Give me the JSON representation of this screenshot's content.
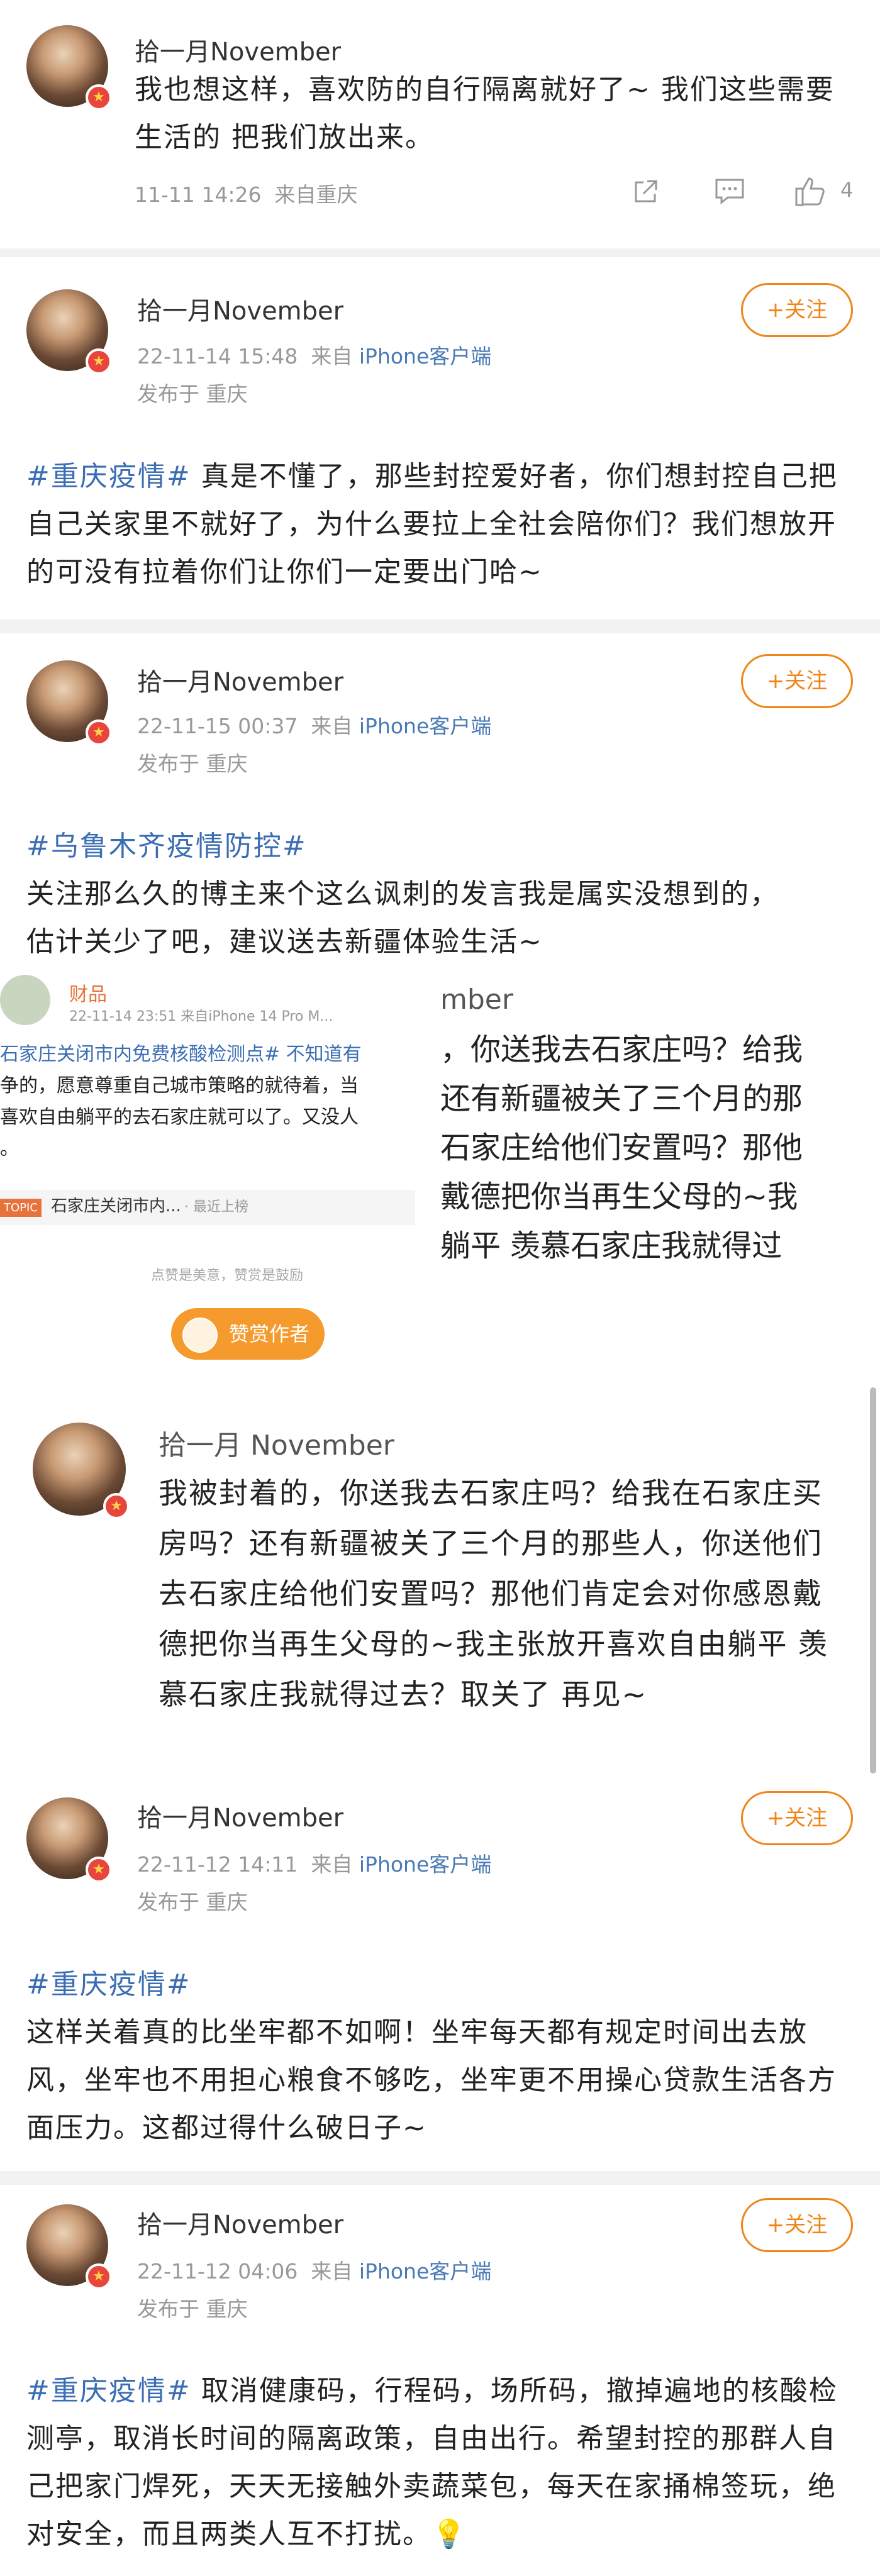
{
  "comment1": {
    "username": "拾一月November",
    "text": "我也想这样，喜欢防的自行隔离就好了~ 我们这些需要生活的 把我们放出来。",
    "time": "11-11 14:26",
    "location": "来自重庆",
    "like_count": "4"
  },
  "post1": {
    "username": "拾一月November",
    "date": "22-11-14 15:48",
    "from": "来自",
    "source": "iPhone客户端",
    "posted_in": "发布于 重庆",
    "follow": "+关注",
    "hashtag": "#重庆疫情#",
    "text": "真是不懂了，那些封控爱好者，你们想封控自己把自己关家里不就好了，为什么要拉上全社会陪你们？我们想放开的可没有拉着你们让你们一定要出门哈~"
  },
  "post2": {
    "username": "拾一月November",
    "date": "22-11-15 00:37",
    "from": "来自",
    "source": "iPhone客户端",
    "posted_in": "发布于 重庆",
    "follow": "+关注",
    "hashtag": "#乌鲁木齐疫情防控#",
    "text": "关注那么久的博主来个这么讽刺的发言我是属实没想到的，估计关少了吧，建议送去新疆体验生活~",
    "embed": {
      "author": "财品",
      "meta": "22-11-14 23:51 来自iPhone 14 Pro M...",
      "line1": "石家庄关闭市内免费核酸检测点# 不知道有",
      "line2": "争的，愿意尊重自己城市策略的就待着，当",
      "line3": "喜欢自由躺平的去石家庄就可以了。又没人",
      "line4": "。",
      "tag_chip": "TOPIC",
      "topic": "石家庄关闭市内...",
      "topic_hint": "· 最近上榜",
      "reward_note": "点赞是美意，赞赏是鼓励",
      "reward_btn": "赞赏作者",
      "right_name": "mber",
      "right_lines": [
        "，你送我去石家庄吗？给我",
        "还有新疆被关了三个月的那",
        "石家庄给他们安置吗？那他",
        "戴德把你当再生父母的~我",
        "躺平  羡慕石家庄我就得过"
      ]
    }
  },
  "reply": {
    "username": "拾一月 November",
    "text": "我被封着的，你送我去石家庄吗？给我在石家庄买房吗？还有新疆被关了三个月的那些人，你送他们去石家庄给他们安置吗？那他们肯定会对你感恩戴德把你当再生父母的~我主张放开喜欢自由躺平  羡慕石家庄我就得过去？取关了 再见~"
  },
  "post3": {
    "username": "拾一月November",
    "date": "22-11-12 14:11",
    "from": "来自",
    "source": "iPhone客户端",
    "posted_in": "发布于 重庆",
    "follow": "+关注",
    "hashtag": "#重庆疫情#",
    "text": "这样关着真的比坐牢都不如啊！坐牢每天都有规定时间出去放风，坐牢也不用担心粮食不够吃，坐牢更不用操心贷款生活各方面压力。这都过得什么破日子~"
  },
  "post4": {
    "username": "拾一月November",
    "date": "22-11-12 04:06",
    "from": "来自",
    "source": "iPhone客户端",
    "posted_in": "发布于 重庆",
    "follow": "+关注",
    "hashtag": "#重庆疫情#",
    "text": "取消健康码，行程码，场所码，撤掉遍地的核酸检测亭，取消长时间的隔离政策，自由出行。希望封控的那群人自己把家门焊死，天天无接触外卖蔬菜包，每天在家捅棉签玩，绝对安全，而且两类人互不打扰。"
  },
  "colors": {
    "accent": "#f08519",
    "link": "#3b6db3",
    "source": "#4a7ab5"
  }
}
